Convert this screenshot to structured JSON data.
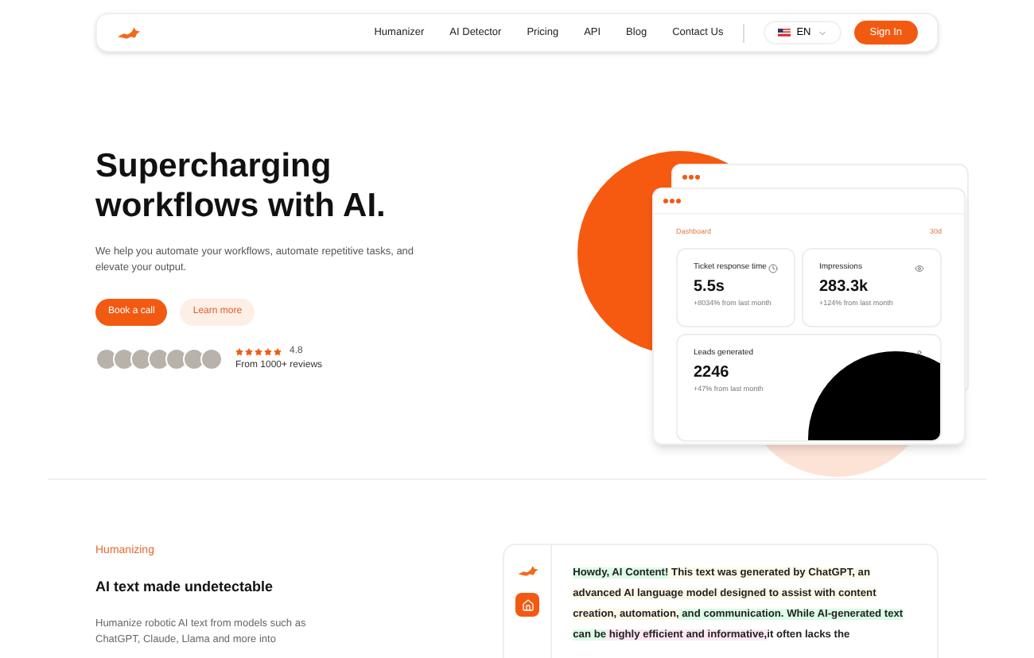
{
  "nav": {
    "links": [
      "Humanizer",
      "AI Detector",
      "Pricing",
      "API",
      "Blog",
      "Contact Us"
    ],
    "language": "EN",
    "signin": "Sign In"
  },
  "hero": {
    "title_lines": [
      "Supercharging",
      "workflows with AI."
    ],
    "subtitle": "We help you automate your workflows, automate repetitive tasks, and elevate your output.",
    "primary": "Book a call",
    "secondary": "Learn more",
    "rating": {
      "stars": 5,
      "score": "4.8",
      "reviews": "From 1000+ reviews"
    }
  },
  "dashboard": {
    "title": "Dashboard",
    "period": "30d",
    "cards": [
      {
        "label": "Ticket response time",
        "value": "5.5s",
        "change": "+8034% from last month"
      },
      {
        "label": "Impressions",
        "value": "283.3k",
        "change": "+124% from last month"
      },
      {
        "label": "Leads generated",
        "value": "2246",
        "change": "+47% from last month"
      }
    ]
  },
  "feature": {
    "eyebrow": "Humanizing",
    "heading": "AI text made undetectable",
    "body": "Humanize robotic AI text from models such as ChatGPT, Claude, Llama and more into"
  },
  "sample": {
    "segments": [
      {
        "text": "Howdy, AI Content!",
        "color": "#dcfce7"
      },
      {
        "text": " This text was generated by ChatGPT, an advanced AI language model designed to assist with content creation, automation,",
        "color": "#fef9e7"
      },
      {
        "text": " and communication. While AI-generated text can be",
        "color": "#dcfce7"
      },
      {
        "text": " highly efficient and informative,",
        "color": "#fce7f3"
      },
      {
        "text": "it often lacks the",
        "color": "#ffffff"
      }
    ]
  }
}
